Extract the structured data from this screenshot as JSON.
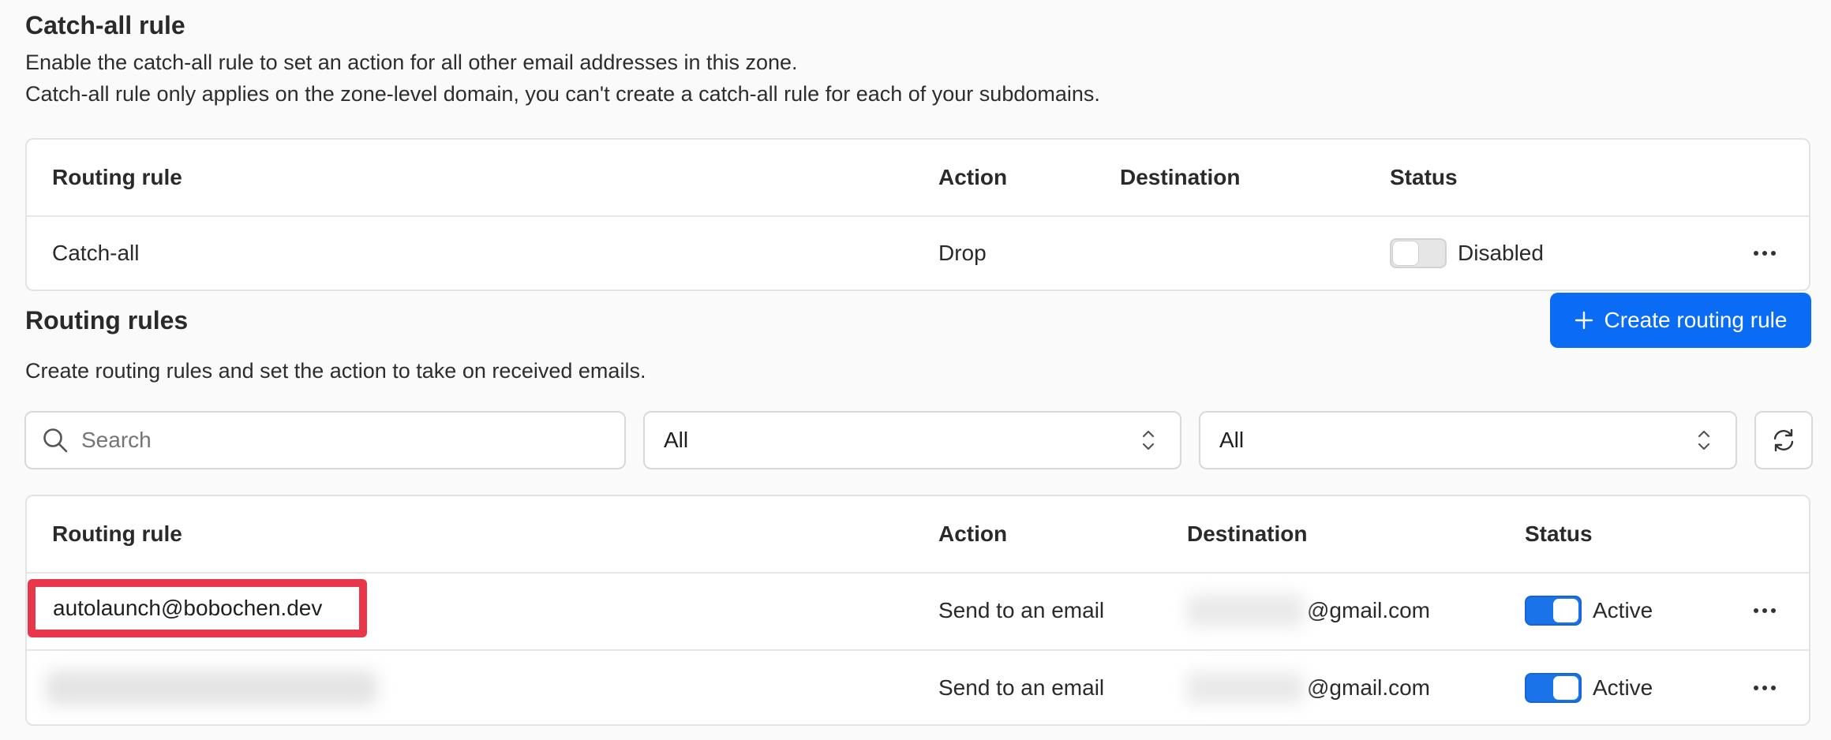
{
  "catch_all": {
    "title": "Catch-all rule",
    "desc_line1": "Enable the catch-all rule to set an action for all other email addresses in this zone.",
    "desc_line2": "Catch-all rule only applies on the zone-level domain, you can't create a catch-all rule for each of your subdomains.",
    "headers": {
      "rule": "Routing rule",
      "action": "Action",
      "destination": "Destination",
      "status": "Status"
    },
    "row": {
      "rule": "Catch-all",
      "action": "Drop",
      "destination": "",
      "status": "Disabled",
      "enabled": false
    }
  },
  "routing": {
    "title": "Routing rules",
    "desc": "Create routing rules and set the action to take on received emails.",
    "create_button": "Create routing rule",
    "search_placeholder": "Search",
    "filter1_value": "All",
    "filter2_value": "All",
    "headers": {
      "rule": "Routing rule",
      "action": "Action",
      "destination": "Destination",
      "status": "Status"
    },
    "rows": [
      {
        "rule": "autolaunch@bobochen.dev",
        "action": "Send to an email",
        "destination_suffix": "@gmail.com",
        "status": "Active",
        "enabled": true
      },
      {
        "rule": "",
        "action": "Send to an email",
        "destination_suffix": "@gmail.com",
        "status": "Active",
        "enabled": true
      }
    ]
  },
  "colors": {
    "accent": "#0a6cf5",
    "toggle_on": "#1a73e8",
    "highlight": "#e8374a"
  },
  "icons": {
    "more": "more-horizontal-icon",
    "search": "search-icon",
    "refresh": "refresh-icon",
    "plus": "plus-icon",
    "select": "chevron-up-down-icon"
  }
}
